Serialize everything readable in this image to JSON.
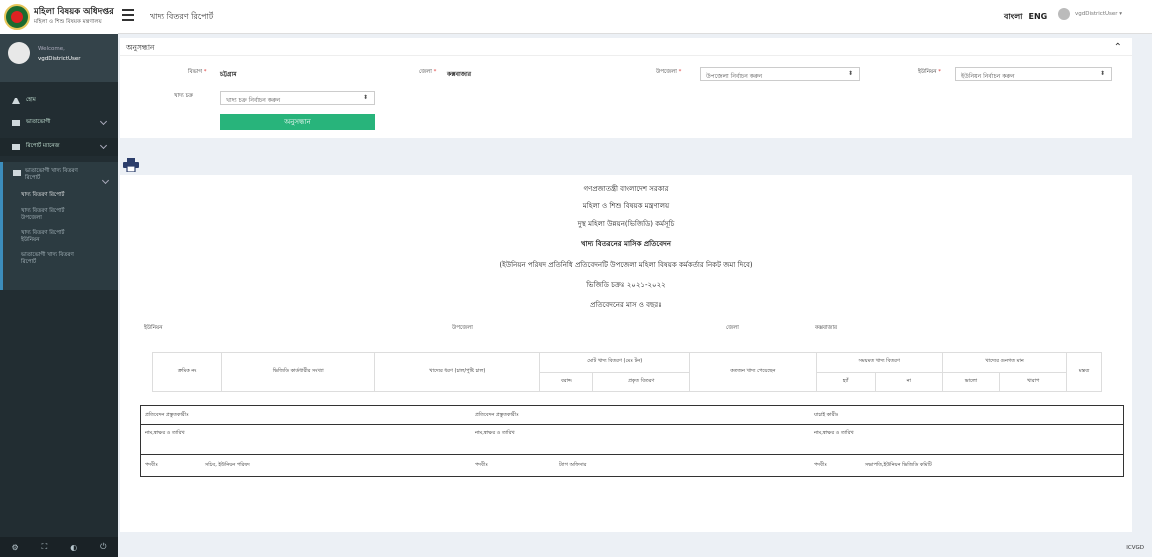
{
  "header": {
    "brand_line1": "মহিলা বিষয়ক অধিদপ্তর",
    "brand_line2": "মহিলা ও শিশু বিষয়ক মন্ত্রণালয়",
    "page_title": "খাদ্য বিতরণ রিপোর্ট",
    "lang_bn": "বাংলা",
    "lang_en": "ENG",
    "user": "vgdDistrictUser"
  },
  "sidebar": {
    "welcome": "Welcome,",
    "username": "vgdDistrictUser",
    "items": [
      {
        "label": "হোম"
      },
      {
        "label": "ভাতাভোগী"
      },
      {
        "label": "রিপোর্ট ম্যানেজ"
      }
    ],
    "sub_parent": "ভাতাভোগী খাদ্য বিতরণ রিপোর্ট",
    "sub_items": [
      {
        "label": "খাদ্য বিতরণ রিপোর্ট"
      },
      {
        "label": "খাদ্য বিতরণ রিপোর্ট উপজেলা"
      },
      {
        "label": "খাদ্য বিতরণ রিপোর্ট ইউনিয়ন"
      },
      {
        "label": "ভাতাভোগী খাদ্য বিতরণ রিপোর্ট"
      }
    ]
  },
  "search": {
    "title": "অনুসন্ধান",
    "division_label": "বিভাগ",
    "division_value": "চট্টগ্রাম",
    "district_label": "জেলা",
    "district_value": "কক্সবাজার",
    "upazila_label": "উপজেলা",
    "upazila_placeholder": "উপজেলা নির্বাচন করুন",
    "union_label": "ইউনিয়ন",
    "union_placeholder": "ইউনিয়ন নির্বাচন করুন",
    "cycle_label": "খাদ্য চক্র",
    "cycle_placeholder": "খাদ্য চক্র নির্বাচন করুন",
    "button": "অনুসন্ধান"
  },
  "report": {
    "line1": "গণপ্রজাতন্ত্রী বাংলাদেশ সরকার",
    "line2": "মহিলা ও শিশু বিষয়ক মন্ত্রণালয়",
    "line3": "দুস্থ মহিলা উন্নয়ন(ভিজিডি) কর্মসূচি",
    "line4": "খাদ্য বিতরনের মাসিক প্রতিবেদন",
    "line5": "(ইউনিয়ন পরিষদ প্রতিনিধি প্রতিবেদনটি উপজেলা মহিলা বিষয়ক কর্মকর্তার নিকট জমা দিবে)",
    "line6": "ভিজিডি চক্রঃ ২০২১-২০২২",
    "line7": "প্রতিবেদনের মাস ও বছরঃ",
    "meta_union": "ইউনিয়ন",
    "meta_upazila": "উপজেলা",
    "meta_district": "জেলা",
    "meta_district_value": "কক্সবাজার",
    "table": {
      "serial": "ক্রমিক নং",
      "beneficiaries": "ভিজিডি কার্ডধারীর সংখ্যা",
      "food_type": "খাদ্যের ধরণ (চাল/পুষ্টি চাল)",
      "total_dist": "মোট খাদ্য বিতরণ (মেঃ টন)",
      "allotted": "বরাদ্দ",
      "actual": "প্রকৃত বিতরণ",
      "received_count": "কতজন খাদ্য পেয়েছেন",
      "ontime": "সময়মত খাদ্য বিতরণ",
      "yes": "হ্যাঁ",
      "no": "না",
      "quality": "খাদ্যের গুনগত মান",
      "good": "ভালো",
      "bad": "খারাপ",
      "remarks": "মন্তব্য"
    },
    "sign": {
      "prepared": "প্রতিবেদন প্রস্তুতকারীঃ",
      "prepared2": "প্রতিবেদন প্রস্তুতকারীঃ",
      "verifier": "যাচাই কারীঃ",
      "sign_date": "নাম,স্বাক্ষর ও তারিখ",
      "sign_date2": "নাম,স্বাক্ষর ও তারিখ",
      "sign_date3": "নাম,স্বাক্ষর ও তারিখ",
      "post": "পদবীঃ",
      "post_value1": "সচিব, ইউনিয়ন পরিষদ",
      "post2": "পদবীঃ",
      "post_value2": "ট্যাগ অফিসার",
      "post3": "পদবীঃ",
      "post_value3": "সভাপতি,ইউনিয়ন ভিজিডি কমিটি"
    }
  },
  "footer": {
    "text": "ICVGD"
  }
}
